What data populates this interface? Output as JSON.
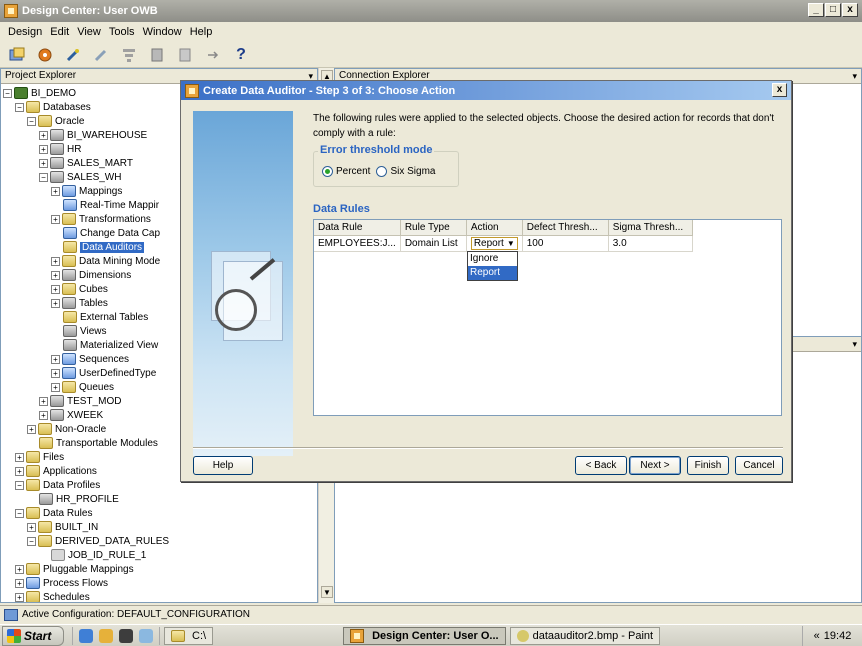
{
  "window": {
    "title": "Design Center: User OWB",
    "min": "_",
    "max": "□",
    "close": "x"
  },
  "menu": [
    "Design",
    "Edit",
    "View",
    "Tools",
    "Window",
    "Help"
  ],
  "toolbar": {
    "help_glyph": "?"
  },
  "explorer": {
    "header": "Project Explorer",
    "nodes": [
      "BI_DEMO",
      "Databases",
      "Oracle",
      "BI_WAREHOUSE",
      "HR",
      "SALES_MART",
      "SALES_WH",
      "Mappings",
      "Real-Time Mappir",
      "Transformations",
      "Change Data Cap",
      "Data Auditors",
      "Data Mining Mode",
      "Dimensions",
      "Cubes",
      "Tables",
      "External Tables",
      "Views",
      "Materialized View",
      "Sequences",
      "UserDefinedType",
      "Queues",
      "TEST_MOD",
      "XWEEK",
      "Non-Oracle",
      "Transportable Modules",
      "Files",
      "Applications",
      "Data Profiles",
      "HR_PROFILE",
      "Data Rules",
      "BUILT_IN",
      "DERIVED_DATA_RULES",
      "JOB_ID_RULE_1",
      "Pluggable Mappings",
      "Process Flows",
      "Schedules"
    ]
  },
  "right_top_header": "Connection Explorer",
  "status": {
    "text": "Active Configuration: DEFAULT_CONFIGURATION"
  },
  "taskbar": {
    "start": "Start",
    "items": [
      "C:\\",
      "Design Center: User O...",
      "dataauditor2.bmp - Paint"
    ],
    "clock": "19:42",
    "chevron": "«"
  },
  "dialog": {
    "title": "Create Data Auditor - Step 3 of 3: Choose Action",
    "close": "x",
    "description": "The following rules were applied to the selected objects. Choose the desired action for records that don't comply with a rule:",
    "threshold": {
      "legend": "Error threshold mode",
      "options": [
        "Percent",
        "Six Sigma"
      ],
      "selected": "Percent"
    },
    "rules_title": "Data Rules",
    "columns": [
      "Data Rule",
      "Rule Type",
      "Action",
      "Defect Thresh...",
      "Sigma Thresh..."
    ],
    "rows": [
      {
        "rule": "EMPLOYEES:J...",
        "type": "Domain List",
        "action": "Report",
        "defect": "100",
        "sigma": "3.0"
      }
    ],
    "action_options": [
      "Ignore",
      "Report"
    ],
    "highlighted_option": "Report",
    "buttons": {
      "help": "Help",
      "back": "< Back",
      "next": "Next >",
      "finish": "Finish",
      "cancel": "Cancel"
    }
  }
}
